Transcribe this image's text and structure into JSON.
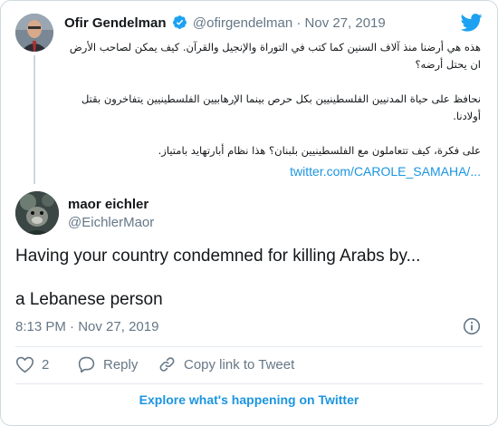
{
  "quoted_tweet": {
    "author_name": "Ofir Gendelman",
    "author_handle": "@ofirgendelman",
    "separator": "·",
    "date": "Nov 27, 2019",
    "lines": [
      "هذه هي أرضنا منذ آلاف السنين كما كتب في التوراة والإنجيل والقرآن. كيف يمكن لصاحب الأرض ان يحتل أرضه؟",
      "نحافظ على حياة المدنيين الفلسطينيين بكل حرص بينما الإرهابيين الفلسطينيين يتفاخرون بقتل أولادنا.",
      "على فكرة، كيف تتعاملون مع الفلسطينيين بلبنان؟ هذا نظام أبارتهايد بامتياز."
    ],
    "link": "twitter.com/CAROLE_SAMAHA/..."
  },
  "tweet": {
    "author_name": "maor eichler",
    "author_handle": "@EichlerMaor",
    "text_line1": "Having your country condemned for killing Arabs by...",
    "text_line2": "a Lebanese person",
    "time": "8:13 PM",
    "separator": "·",
    "date": "Nov 27, 2019"
  },
  "actions": {
    "like_count": "2",
    "reply_label": "Reply",
    "copy_link_label": "Copy link to Tweet"
  },
  "footer": {
    "explore_label": "Explore what's happening on Twitter"
  },
  "icons": {
    "brand": "twitter-bird-icon",
    "verified": "verified-badge-icon",
    "info": "info-icon",
    "like": "heart-icon",
    "reply": "reply-bubble-icon",
    "copy_link": "link-icon"
  },
  "colors": {
    "accent": "#1b95e0",
    "muted": "#657786",
    "text": "#14171a",
    "border": "#cfd9de"
  }
}
